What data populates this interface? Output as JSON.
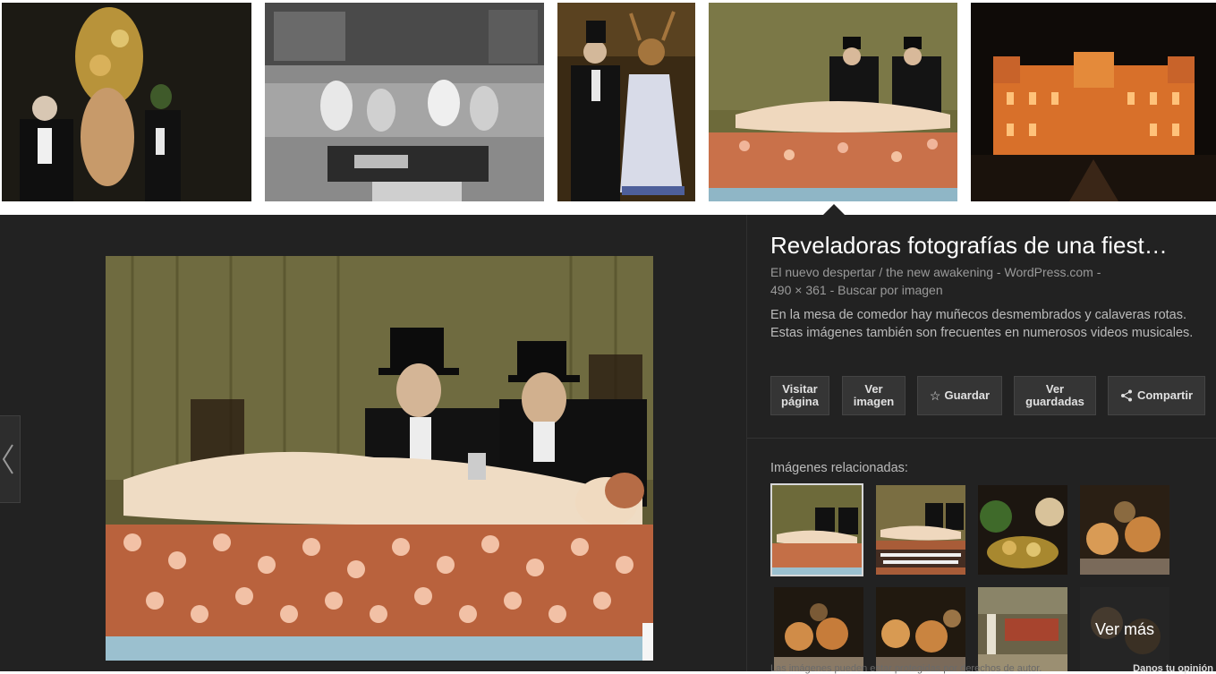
{
  "strip": {
    "thumbnails": [
      {
        "name": "masked-party-guests"
      },
      {
        "name": "living-room-gathering"
      },
      {
        "name": "stag-mask-couple"
      },
      {
        "name": "mannequin-table"
      },
      {
        "name": "illuminated-chateau"
      }
    ]
  },
  "detail": {
    "title": "Reveladoras fotografías de una fiest…",
    "source": "El nuevo despertar / the new awakening - WordPress.com -",
    "dimensions": "490 × 361",
    "separator": "-",
    "search_by_image": "Buscar por imagen",
    "description": "En la mesa de comedor hay muñecos desmembrados y calaveras rotas. Estas imágenes también son frecuentes en numerosos videos musicales."
  },
  "actions": {
    "visit_line1": "Visitar",
    "visit_line2": "página",
    "view_line1": "Ver",
    "view_line2": "imagen",
    "save": "Guardar",
    "saved_line1": "Ver",
    "saved_line2": "guardadas",
    "share": "Compartir",
    "save_icon": "☆"
  },
  "related": {
    "label": "Imágenes relacionadas:",
    "more": "Ver más",
    "footer_note": "Las imágenes pueden estar protegidas por derechos de autor.",
    "feedback": "Danos tu opinión"
  },
  "colors": {
    "panel_bg": "#222222",
    "title": "#ffffff",
    "meta": "#9a9a9a",
    "button_bg": "#353535"
  }
}
